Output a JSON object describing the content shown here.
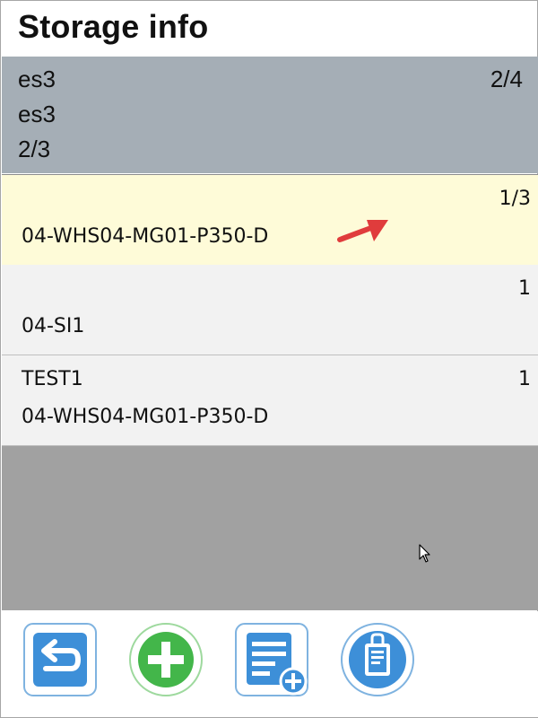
{
  "header": {
    "title": "Storage info",
    "line1": "es3",
    "line2": "es3",
    "line3": "2/3",
    "count": "2/4"
  },
  "rows": [
    {
      "top": "",
      "bottom": "04-WHS04-MG01-P350-D",
      "qty": "1/3",
      "highlighted": true
    },
    {
      "top": "",
      "bottom": "04-SI1",
      "qty": "1",
      "highlighted": false
    },
    {
      "top": "TEST1",
      "bottom": "04-WHS04-MG01-P350-D",
      "qty": "1",
      "highlighted": false
    }
  ],
  "toolbar": {
    "buttons": [
      {
        "icon": "back-arrow-icon"
      },
      {
        "icon": "plus-circle-icon"
      },
      {
        "icon": "list-add-icon"
      },
      {
        "icon": "clipboard-icon"
      }
    ]
  },
  "colors": {
    "header_bg": "#a5aeb6",
    "highlight_bg": "#fefbd8",
    "row_bg": "#f2f2f2",
    "empty_bg": "#a1a1a1",
    "button_blue": "#3d8fd8",
    "button_green": "#43b64a",
    "annotation_red": "#e03c3c"
  }
}
